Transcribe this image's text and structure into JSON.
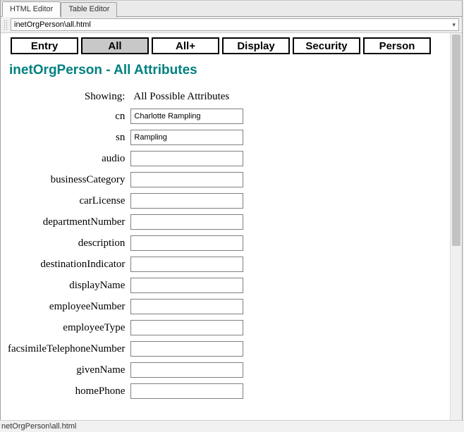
{
  "tabs": {
    "html_editor": "HTML Editor",
    "table_editor": "Table Editor"
  },
  "path": "inetOrgPerson\\all.html",
  "nav_buttons": {
    "entry": "Entry",
    "all": "All",
    "all_plus": "All+",
    "display": "Display",
    "security": "Security",
    "person": "Person"
  },
  "title": "inetOrgPerson - All Attributes",
  "showing_label": "Showing:",
  "showing_value": "All Possible Attributes",
  "fields": {
    "cn": {
      "label": "cn",
      "value": "Charlotte Rampling"
    },
    "sn": {
      "label": "sn",
      "value": "Rampling"
    },
    "audio": {
      "label": "audio",
      "value": ""
    },
    "businessCategory": {
      "label": "businessCategory",
      "value": ""
    },
    "carLicense": {
      "label": "carLicense",
      "value": ""
    },
    "departmentNumber": {
      "label": "departmentNumber",
      "value": ""
    },
    "description": {
      "label": "description",
      "value": ""
    },
    "destinationIndicator": {
      "label": "destinationIndicator",
      "value": ""
    },
    "displayName": {
      "label": "displayName",
      "value": ""
    },
    "employeeNumber": {
      "label": "employeeNumber",
      "value": ""
    },
    "employeeType": {
      "label": "employeeType",
      "value": ""
    },
    "facsimileTelephoneNumber": {
      "label": "facsimileTelephoneNumber",
      "value": ""
    },
    "givenName": {
      "label": "givenName",
      "value": ""
    },
    "homePhone": {
      "label": "homePhone",
      "value": ""
    }
  },
  "status": "netOrgPerson\\all.html"
}
